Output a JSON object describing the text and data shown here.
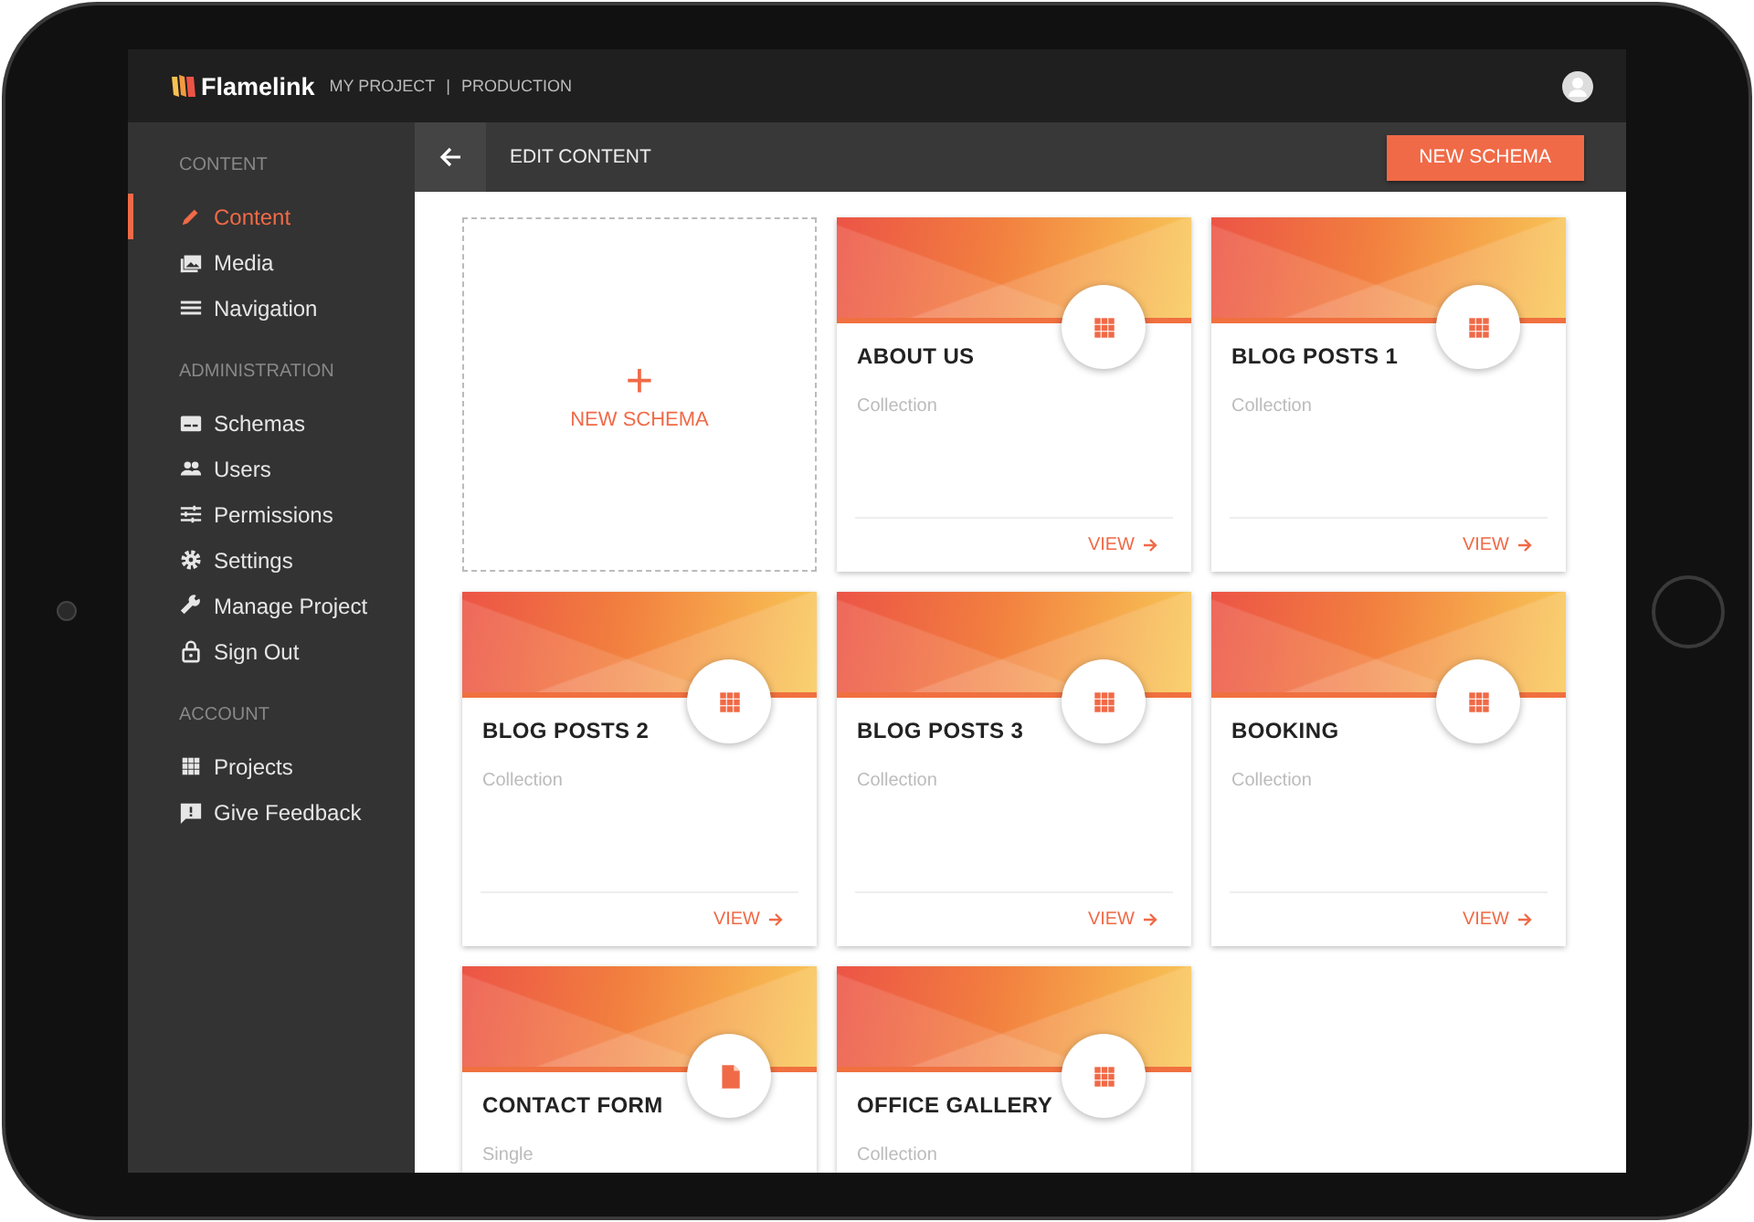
{
  "topbar": {
    "logo": "Flamelink",
    "project": "MY PROJECT",
    "separator": "|",
    "environment": "PRODUCTION"
  },
  "sidebar": {
    "sections": [
      {
        "title": "CONTENT",
        "items": [
          {
            "label": "Content",
            "selected": true
          },
          {
            "label": "Media",
            "selected": false
          },
          {
            "label": "Navigation",
            "selected": false
          }
        ]
      },
      {
        "title": "ADMINISTRATION",
        "items": [
          {
            "label": "Schemas",
            "selected": false
          },
          {
            "label": "Users",
            "selected": false
          },
          {
            "label": "Permissions",
            "selected": false
          },
          {
            "label": "Settings",
            "selected": false
          },
          {
            "label": "Manage Project",
            "selected": false
          },
          {
            "label": "Sign Out",
            "selected": false
          }
        ]
      },
      {
        "title": "ACCOUNT",
        "items": [
          {
            "label": "Projects",
            "selected": false
          },
          {
            "label": "Give Feedback",
            "selected": false
          }
        ]
      }
    ]
  },
  "toolbar": {
    "title": "EDIT CONTENT",
    "button": "NEW SCHEMA"
  },
  "new_schema_card": {
    "symbol": "+",
    "label": "NEW SCHEMA"
  },
  "cards": [
    {
      "title": "ABOUT US",
      "type": "Collection",
      "kind": "collection",
      "action": "VIEW"
    },
    {
      "title": "BLOG POSTS 1",
      "type": "Collection",
      "kind": "collection",
      "action": "VIEW"
    },
    {
      "title": "BLOG POSTS 2",
      "type": "Collection",
      "kind": "collection",
      "action": "VIEW"
    },
    {
      "title": "BLOG POSTS 3",
      "type": "Collection",
      "kind": "collection",
      "action": "VIEW"
    },
    {
      "title": "BOOKING",
      "type": "Collection",
      "kind": "collection",
      "action": "VIEW"
    },
    {
      "title": "CONTACT FORM",
      "type": "Single",
      "kind": "single"
    },
    {
      "title": "OFFICE GALLERY",
      "type": "Collection",
      "kind": "collection"
    }
  ]
}
